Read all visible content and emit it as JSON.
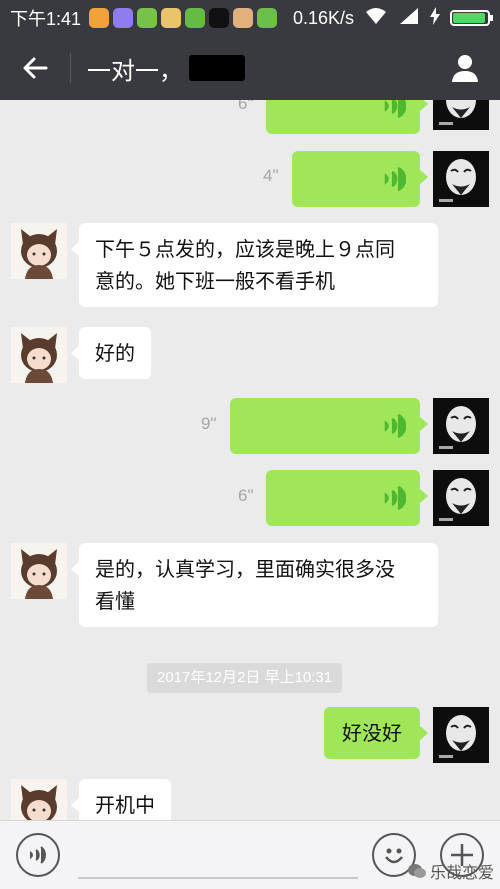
{
  "status_bar": {
    "time": "下午1:41",
    "speed": "0.16K/s",
    "battery_level": 0.95,
    "notification_icons": [
      {
        "name": "app-notification-icon",
        "color": "#f2a23b"
      },
      {
        "name": "app-notification-icon",
        "color": "#8f7df0"
      },
      {
        "name": "app-notification-icon",
        "color": "#77c34a"
      },
      {
        "name": "app-notification-icon",
        "color": "#e9c46a"
      },
      {
        "name": "app-notification-icon",
        "color": "#66bb44"
      },
      {
        "name": "app-notification-icon",
        "color": "#111111"
      },
      {
        "name": "app-notification-icon",
        "color": "#e1b07d"
      },
      {
        "name": "app-notification-icon",
        "color": "#6cc04a"
      }
    ]
  },
  "nav": {
    "title": "一对一，",
    "back_icon": "arrow-left-icon",
    "profile_icon": "person-icon"
  },
  "messages": [
    {
      "side": "out",
      "kind": "voice",
      "duration": "6\""
    },
    {
      "side": "out",
      "kind": "voice",
      "duration": "4\""
    },
    {
      "side": "in",
      "kind": "text",
      "lines": [
        "下午５点发的，应该是晚上９点同",
        "意的。她下班一般不看手机"
      ]
    },
    {
      "side": "in",
      "kind": "text",
      "lines": [
        "好的"
      ]
    },
    {
      "side": "out",
      "kind": "voice",
      "duration": "9\""
    },
    {
      "side": "out",
      "kind": "voice",
      "duration": "6\""
    },
    {
      "side": "in",
      "kind": "text",
      "lines": [
        "是的，认真学习，里面确实很多没",
        "看懂"
      ]
    },
    {
      "side": "out",
      "kind": "text",
      "lines": [
        "好没好"
      ]
    },
    {
      "side": "in",
      "kind": "text",
      "lines": [
        "开机中"
      ]
    }
  ],
  "timestamp": "2017年12月2日 早上10:31",
  "input_bar": {
    "voice_icon": "voice-mode-icon",
    "emoji_icon": "emoji-icon",
    "add_icon": "plus-icon"
  },
  "watermark": "乐哉恋爱",
  "colors": {
    "header": "#393a3f",
    "background": "#ebebeb",
    "outgoing_bubble": "#9fe658",
    "incoming_bubble": "#ffffff",
    "wave": "#4db830"
  }
}
